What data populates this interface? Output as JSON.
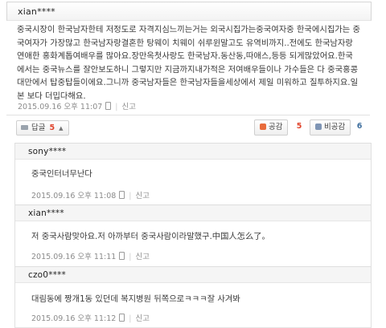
{
  "main_comment": {
    "username": "xian****",
    "body": "중국시장이 한국남자한테 저정도로 자격지심느끼는거는 외국시집가는중국여자중 한국에시집가는 중국여자가 가장많고 한국남자랑결혼한 탕웨이 치웨이 쉬루윈말고도 유역비까지..전에도 한국남자랑연애한 홍화계톱여배우를 많아요.장만옥첫사랑도 한국남자.동산동,따애스,등등 되게많았어요.한국에서는 중국뉴스를 잘안보도하니 그렇지만 지금까지내가적은 저여배우들이나 가수들은 다 중국홍콩대만에서 탑중탑들이에요.그니까 중국남자들은 한국남자들을세상에서 제일 미워하고 질투하지요.일본 보다 더밉다해요.",
    "timestamp": "2015.09.16 오후 11:07",
    "report_label": "신고",
    "reply_button_label": "답글",
    "reply_count": "5",
    "like_label": "공감",
    "like_count": "5",
    "dislike_label": "비공감",
    "dislike_count": "6"
  },
  "replies": [
    {
      "username": "sony****",
      "text": "중국인터너무난다",
      "timestamp": "2015.09.16 오후 11:08",
      "report_label": "신고"
    },
    {
      "username": "xian****",
      "text": "저 중국사람맞아요.저 아까부터 중국사람이라말했구.中国人怎么了。",
      "timestamp": "2015.09.16 오후 11:11",
      "report_label": "신고"
    },
    {
      "username": "czo0****",
      "text": "대림동에 짱개1동 있던데 복지병원 뒤쪽으로ㅋㅋㅋ잘 사겨봐",
      "timestamp": "2015.09.16 오후 11:12",
      "report_label": "신고"
    }
  ]
}
